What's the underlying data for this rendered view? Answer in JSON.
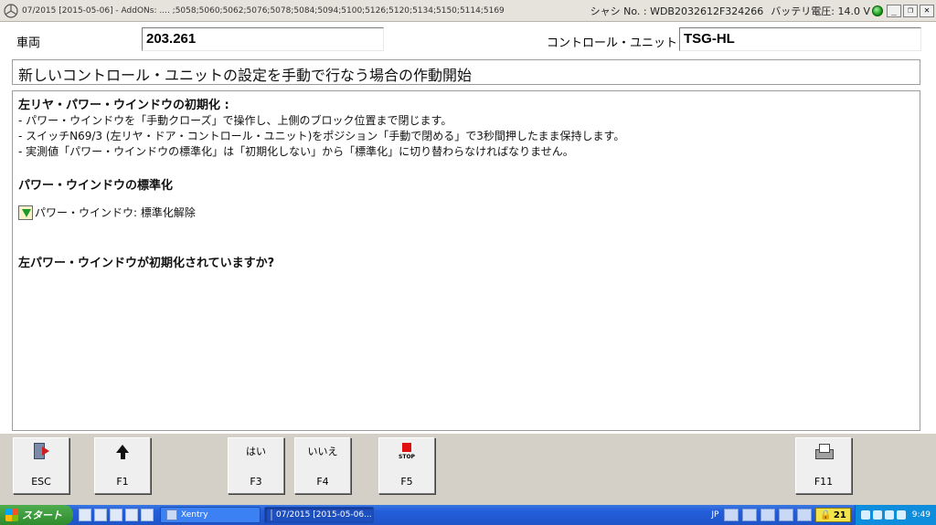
{
  "window": {
    "title": "07/2015 [2015-05-06] - AddONs:  ....  ;5058;5060;5062;5076;5078;5084;5094;5100;5126;5120;5134;5150;5114;5169",
    "chassis": "シャシ No. : WDB2032612F324266",
    "battery": "バッテリ電圧: 14.0 V",
    "min": "_",
    "restore": "❐",
    "close": "✕"
  },
  "vehicle": {
    "label": "車両",
    "value": "203.261",
    "unit_label": "コントロール・ユニット",
    "unit_value": "TSG-HL"
  },
  "headline": "新しいコントロール・ユニットの設定を手動で行なう場合の作動開始",
  "panel": {
    "heading": "左リヤ・パワー・ウインドウの初期化 :",
    "lines": [
      "- パワー・ウインドウを「手動クローズ」で操作し、上側のブロック位置まで閉じます。",
      "- スイッチN69/3 (左リヤ・ドア・コントロール・ユニット)をポジション「手動で閉める」で3秒間押したまま保持します。",
      "- 実測値「パワー・ウインドウの標準化」は「初期化しない」から「標準化」に切り替わらなければなりません。"
    ],
    "section": "パワー・ウインドウの標準化",
    "status": "パワー・ウインドウ: 標準化解除",
    "question": "左パワー・ウインドウが初期化されていますか?"
  },
  "fkeys": {
    "esc": {
      "label": "ESC"
    },
    "f1": {
      "label": "F1"
    },
    "f3": {
      "top": "はい",
      "label": "F3"
    },
    "f4": {
      "top": "いいえ",
      "label": "F4"
    },
    "f5": {
      "top": "STOP",
      "label": "F5"
    },
    "f11": {
      "label": "F11"
    }
  },
  "taskbar": {
    "start": "スタート",
    "tasks": [
      {
        "label": "Xentry"
      },
      {
        "label": "07/2015 [2015-05-06..."
      }
    ],
    "ime": "JP",
    "badge": "21",
    "clock": "9:49"
  },
  "colors": {
    "status_ok": "#1a9d1a",
    "stop": "#e01010",
    "taskbar": "#245edb"
  }
}
